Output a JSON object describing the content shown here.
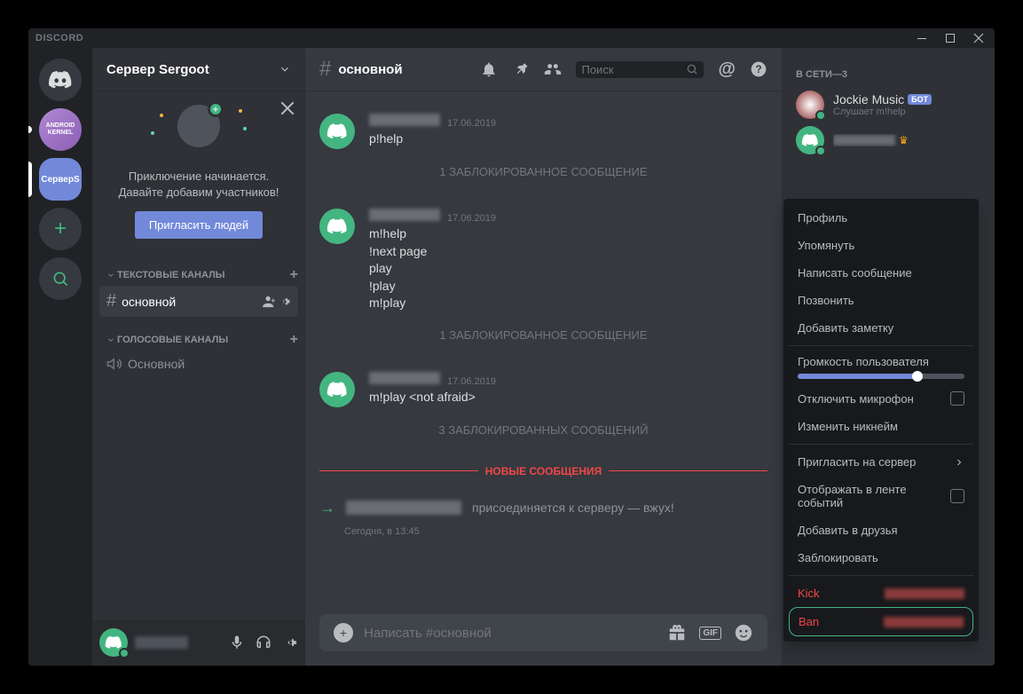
{
  "titlebar": {
    "logo": "DISCORD"
  },
  "servers": {
    "android_label": "ANDROID KERNEL",
    "selected_label": "СерверS"
  },
  "channels": {
    "server_name": "Сервер Sergoot",
    "invite": {
      "text_line1": "Приключение начинается.",
      "text_line2": "Давайте добавим участников!",
      "button": "Пригласить людей"
    },
    "text_category": "ТЕКСТОВЫЕ КАНАЛЫ",
    "text_channel": "основной",
    "voice_category": "ГОЛОСОВЫЕ КАНАЛЫ",
    "voice_channel": "Основной"
  },
  "chat": {
    "channel_name": "основной",
    "search_placeholder": "Поиск",
    "messages": [
      {
        "date": "17.06.2019",
        "lines": [
          "p!help"
        ]
      },
      {
        "date": "17.06.2019",
        "lines": [
          "m!help",
          "!next page",
          "play",
          "!play",
          "m!play"
        ]
      },
      {
        "date": "17.06.2019",
        "lines": [
          "m!play <not afraid>"
        ]
      }
    ],
    "blocked1": "1 ЗАБЛОКИРОВАННОЕ СООБЩЕНИЕ",
    "blocked2": "1 ЗАБЛОКИРОВАННОЕ СООБЩЕНИЕ",
    "blocked3": "3 ЗАБЛОКИРОВАННЫХ СООБЩЕНИЙ",
    "new_divider": "НОВЫЕ СООБЩЕНИЯ",
    "join_text": "присоединяется к серверу — вжух!",
    "join_time": "Сегодня, в 13:45",
    "compose_placeholder": "Написать #основной"
  },
  "members": {
    "header": "В СЕТИ—3",
    "bot_name": "Jockie Music",
    "bot_tag": "БОТ",
    "bot_activity": "Слушает m!help"
  },
  "context_menu": {
    "profile": "Профиль",
    "mention": "Упомянуть",
    "message": "Написать сообщение",
    "call": "Позвонить",
    "note": "Добавить заметку",
    "volume": "Громкость пользователя",
    "mute": "Отключить микрофон",
    "nickname": "Изменить никнейм",
    "invite": "Пригласить на сервер",
    "feed": "Отображать в ленте событий",
    "friend": "Добавить в друзья",
    "block": "Заблокировать",
    "kick": "Kick",
    "ban": "Ban"
  }
}
